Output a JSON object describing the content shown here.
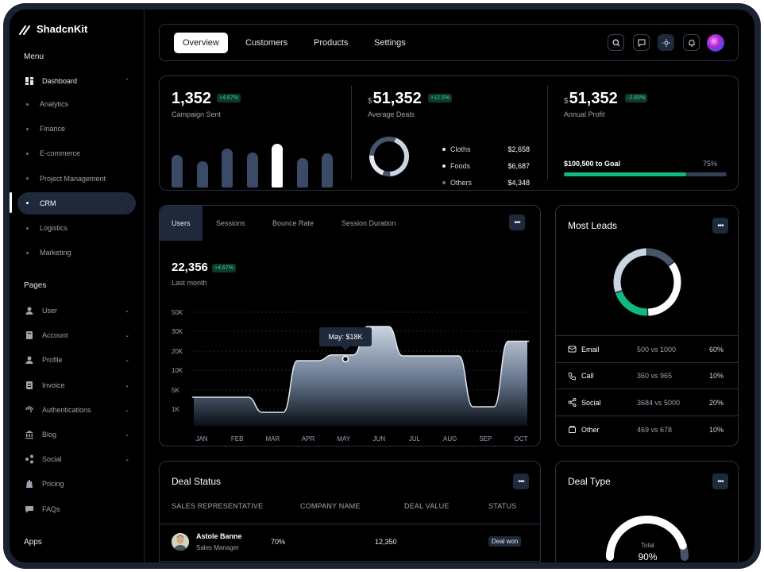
{
  "app": {
    "name": "ShadcnKit"
  },
  "sidebar": {
    "menu_title": "Menu",
    "dashboard_label": "Dashboard",
    "dashboard_items": [
      {
        "label": "Analytics"
      },
      {
        "label": "Finance"
      },
      {
        "label": "E-commerce"
      },
      {
        "label": "Project Management"
      },
      {
        "label": "CRM",
        "active": true
      },
      {
        "label": "Logistics"
      },
      {
        "label": "Marketing"
      }
    ],
    "pages_title": "Pages",
    "pages_items": [
      {
        "label": "User",
        "icon": "user-icon",
        "expandable": true
      },
      {
        "label": "Account",
        "icon": "account-icon",
        "expandable": true
      },
      {
        "label": "Profile",
        "icon": "profile-icon",
        "expandable": true
      },
      {
        "label": "Invoice",
        "icon": "invoice-icon",
        "expandable": true
      },
      {
        "label": "Authentications",
        "icon": "fingerprint-icon",
        "expandable": true
      },
      {
        "label": "Blog",
        "icon": "bank-icon",
        "expandable": true
      },
      {
        "label": "Social",
        "icon": "share-icon",
        "expandable": true
      },
      {
        "label": "Pricing",
        "icon": "price-tag-icon",
        "expandable": false
      },
      {
        "label": "FAQs",
        "icon": "chat-icon",
        "expandable": false
      }
    ],
    "apps_title": "Apps"
  },
  "topbar": {
    "tabs": [
      {
        "label": "Overview",
        "active": true
      },
      {
        "label": "Customers"
      },
      {
        "label": "Products"
      },
      {
        "label": "Settings"
      }
    ]
  },
  "stats": {
    "campaign": {
      "value": "1,352",
      "change": "+4.67%",
      "label": "Campaign Sent",
      "bars": [
        0.68,
        0.55,
        0.82,
        0.74,
        0.92,
        0.62,
        0.72
      ],
      "highlight_index": 4
    },
    "deals": {
      "currency": "$",
      "value": "51,352",
      "change": "+12.5%",
      "label": "Average Deals",
      "breakdown": [
        {
          "name": "Cloths",
          "amount": "$2,658"
        },
        {
          "name": "Foods",
          "amount": "$6,687"
        },
        {
          "name": "Others",
          "amount": "$4,348"
        }
      ]
    },
    "profit": {
      "currency": "$",
      "value": "51,352",
      "change": "-2.65%",
      "label": "Annual Profit",
      "goal_text": "$100,500 to Goal",
      "goal_percent": "75%",
      "goal_fraction": 0.75
    }
  },
  "users_chart": {
    "tabs": [
      "Users",
      "Sessions",
      "Bounce Rate",
      "Session Duration"
    ],
    "value": "22,356",
    "change": "+4.67%",
    "period": "Last month",
    "tooltip": "May: $18K"
  },
  "chart_data": {
    "type": "area",
    "categories": [
      "JAN",
      "FEB",
      "MAR",
      "APR",
      "MAY",
      "JUN",
      "JUL",
      "AUG",
      "SEP",
      "OCT"
    ],
    "values": [
      3.5,
      3.5,
      0.8,
      15,
      18,
      35,
      17.5,
      17.5,
      1.5,
      25
    ],
    "yticks": [
      "50K",
      "30K",
      "20K",
      "10K",
      "5K",
      "1K"
    ],
    "ylim": [
      0,
      50
    ],
    "grid": true
  },
  "leads": {
    "title": "Most Leads",
    "segments": [
      {
        "name": "Email",
        "fraction": 0.6,
        "color": "#cbd5e1"
      },
      {
        "name": "Call",
        "fraction": 0.1,
        "color": "#ffffff"
      },
      {
        "name": "Social",
        "fraction": 0.2,
        "color": "#10b981"
      },
      {
        "name": "Other",
        "fraction": 0.1,
        "color": "#475569"
      }
    ],
    "rows": [
      {
        "channel": "Email",
        "icon": "mail-icon",
        "compare": "500 vs 1000",
        "percent": "60%"
      },
      {
        "channel": "Call",
        "icon": "phone-icon",
        "compare": "360 vs 965",
        "percent": "10%"
      },
      {
        "channel": "Social",
        "icon": "share-icon",
        "compare": "3684 vs 5000",
        "percent": "20%"
      },
      {
        "channel": "Other",
        "icon": "box-icon",
        "compare": "469 vs 678",
        "percent": "10%"
      }
    ]
  },
  "deal_status": {
    "title": "Deal Status",
    "columns": [
      "SALES REPRESENTATIVE",
      "COMPANY NAME",
      "DEAL VALUE",
      "STATUS"
    ],
    "rows": [
      {
        "name": "Astole Banne",
        "role": "Sales Manager",
        "company": "70%",
        "value": "12,350",
        "status": "Deal won"
      }
    ]
  },
  "deal_type": {
    "title": "Deal Type",
    "gauge_label": "Total",
    "gauge_value": "90%",
    "fraction": 0.9
  }
}
